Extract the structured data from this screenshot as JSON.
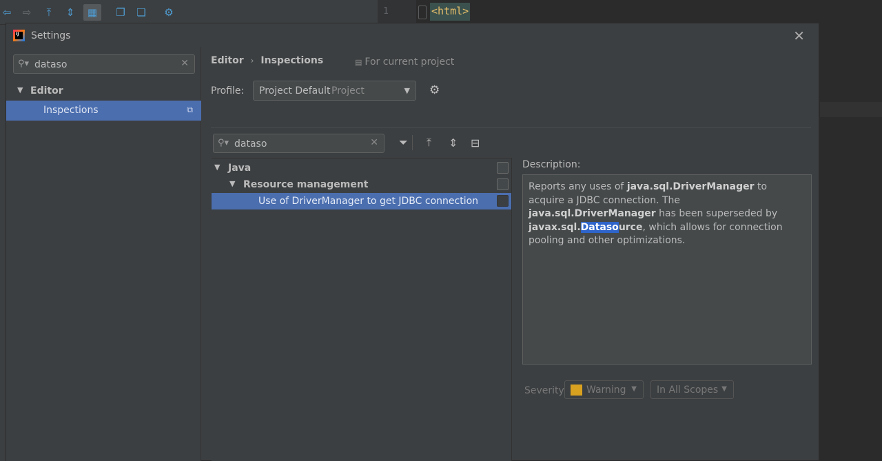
{
  "ide": {
    "editor_line_number": "1",
    "editor_code": "<html>"
  },
  "dialog": {
    "title": "Settings",
    "close_label": "✕"
  },
  "left_panel": {
    "search_value": "dataso",
    "tree": {
      "editor_label": "Editor",
      "inspections_label": "Inspections"
    }
  },
  "header": {
    "breadcrumb": [
      "Editor",
      "Inspections"
    ],
    "breadcrumb_separator": "›",
    "scope_note": "For current project"
  },
  "profile": {
    "label": "Profile:",
    "name": "Project Default",
    "tag": "Project"
  },
  "inspections": {
    "search_value": "dataso",
    "tree": {
      "java": "Java",
      "resource_management": "Resource management",
      "driver_manager": "Use of DriverManager to get JDBC connection"
    }
  },
  "description": {
    "label": "Description:",
    "p1": "Reports any uses of ",
    "b1": "java.sql.DriverManager",
    "p2": " to acquire a JDBC connection. The ",
    "b2": "java.sql.DriverManager",
    "p3": " has been superseded by ",
    "b3_pre": "javax.sql.",
    "b3_hl": "Dataso",
    "b3_post": "urce",
    "p4": ", which allows for connection pooling and other optimizations."
  },
  "severity": {
    "label": "Severity:",
    "value": "Warning",
    "color": "#d9a120",
    "scope": "In All Scopes"
  },
  "colors": {
    "selection": "#4b6eaf",
    "panel": "#3c3f41",
    "highlight": "#2f65ca"
  }
}
